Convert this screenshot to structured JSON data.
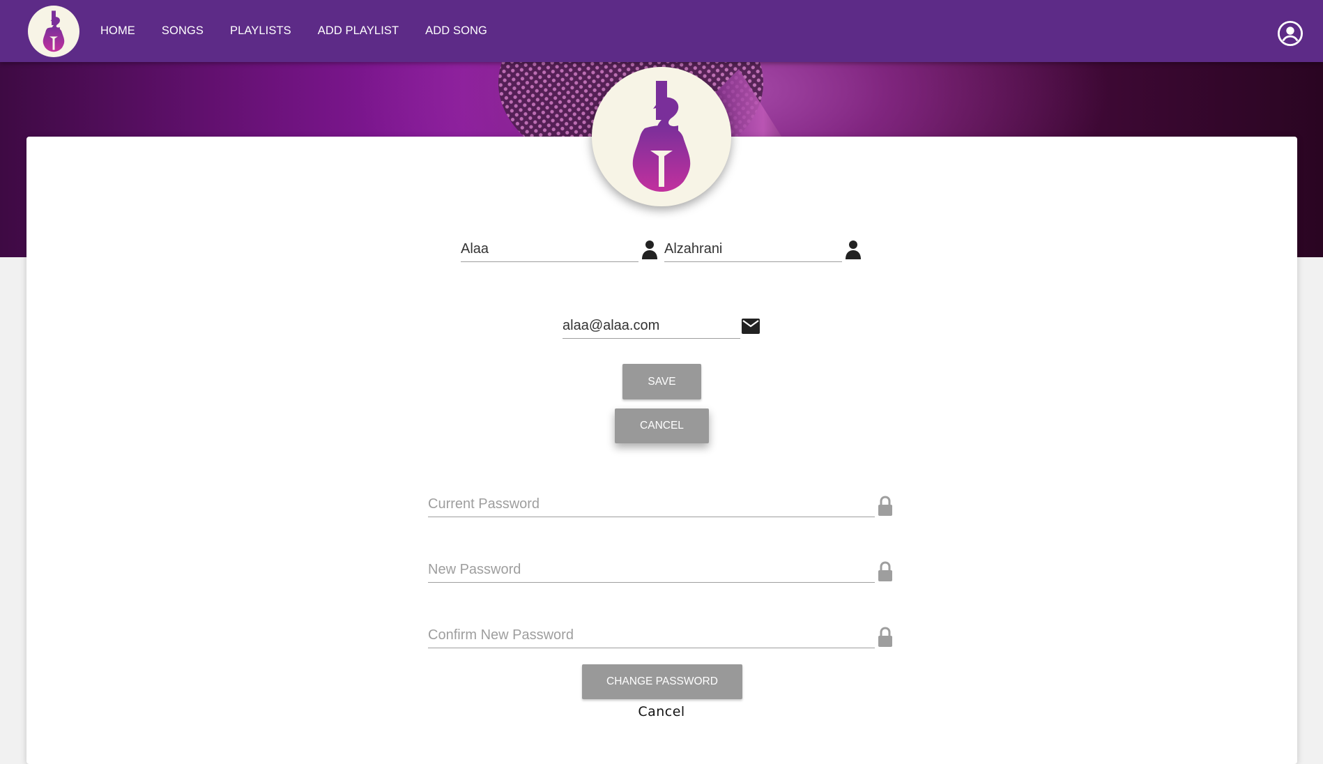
{
  "nav": {
    "logo_icon": "cello-music-logo",
    "links": [
      {
        "label": "HOME"
      },
      {
        "label": "SONGS"
      },
      {
        "label": "PLAYLISTS"
      },
      {
        "label": "ADD PLAYLIST"
      },
      {
        "label": "ADD SONG"
      }
    ],
    "account_icon": "account-circle-icon"
  },
  "profile": {
    "avatar_icon": "cello-music-logo",
    "first_name": "Alaa",
    "last_name": "Alzahrani",
    "email": "alaa@alaa.com",
    "save_label": "SAVE",
    "cancel_label": "CANCEL"
  },
  "password": {
    "current_placeholder": "Current Password",
    "new_placeholder": "New Password",
    "confirm_placeholder": "Confirm New Password",
    "change_label": "CHANGE PASSWORD",
    "cancel_link": "Cancel"
  },
  "colors": {
    "navbar": "#5d2b87",
    "button": "#999999",
    "logo_background": "#f7f4e6",
    "logo_accent": "#8e2c9a"
  }
}
